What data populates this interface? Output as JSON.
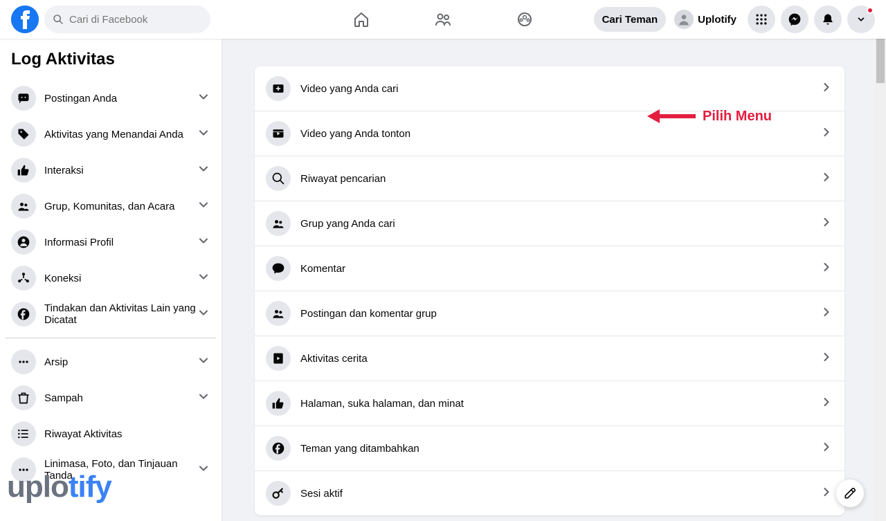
{
  "header": {
    "search_placeholder": "Cari di Facebook",
    "find_friends": "Cari Teman",
    "profile_name": "Uplotify"
  },
  "sidebar": {
    "title": "Log Aktivitas",
    "items": [
      {
        "label": "Postingan Anda",
        "icon": "comment"
      },
      {
        "label": "Aktivitas yang Menandai Anda",
        "icon": "tag"
      },
      {
        "label": "Interaksi",
        "icon": "thumb"
      },
      {
        "label": "Grup, Komunitas, dan Acara",
        "icon": "group"
      },
      {
        "label": "Informasi Profil",
        "icon": "user"
      },
      {
        "label": "Koneksi",
        "icon": "connect"
      },
      {
        "label": "Tindakan dan Aktivitas Lain yang Dicatat",
        "icon": "fb"
      }
    ],
    "items2": [
      {
        "label": "Arsip",
        "icon": "dots"
      },
      {
        "label": "Sampah",
        "icon": "trash"
      },
      {
        "label": "Riwayat Aktivitas",
        "icon": "list",
        "no_chevron": true
      },
      {
        "label": "Linimasa, Foto, dan Tinjauan Tanda",
        "icon": "dots"
      }
    ]
  },
  "main": {
    "items": [
      {
        "label": "Video yang Anda cari",
        "icon": "video-add"
      },
      {
        "label": "Video yang Anda tonton",
        "icon": "video-play"
      },
      {
        "label": "Riwayat pencarian",
        "icon": "search"
      },
      {
        "label": "Grup yang Anda cari",
        "icon": "group"
      },
      {
        "label": "Komentar",
        "icon": "comment-solid"
      },
      {
        "label": "Postingan dan komentar grup",
        "icon": "group"
      },
      {
        "label": "Aktivitas cerita",
        "icon": "story"
      },
      {
        "label": "Halaman, suka halaman, dan minat",
        "icon": "thumb"
      },
      {
        "label": "Teman yang ditambahkan",
        "icon": "fb"
      },
      {
        "label": "Sesi aktif",
        "icon": "key"
      }
    ]
  },
  "annotation": {
    "text": "Pilih Menu"
  },
  "watermark": {
    "part1": "uplo",
    "part2": "tify"
  }
}
